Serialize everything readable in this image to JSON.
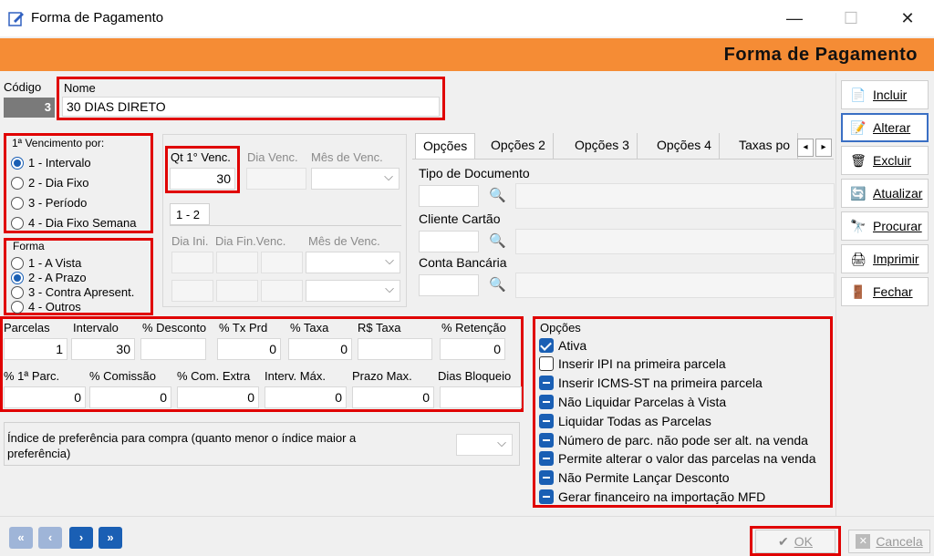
{
  "window": {
    "title": "Forma de Pagamento",
    "minimize_icon": "minimize-icon",
    "maximize_icon": "maximize-icon",
    "close_icon": "close-icon"
  },
  "header": {
    "title": "Forma de Pagamento"
  },
  "codigo": {
    "label": "Código",
    "value": "3"
  },
  "nome": {
    "label": "Nome",
    "value": "30 DIAS DIRETO"
  },
  "vencimento": {
    "label": "1ª Vencimento por:",
    "options": [
      "1 - Intervalo",
      "2 - Dia Fixo",
      "3 - Período",
      "4 - Dia Fixo Semana"
    ],
    "selected": 0
  },
  "forma": {
    "label": "Forma",
    "options": [
      "1 - A Vista",
      "2 - A Prazo",
      "3 - Contra Apresent.",
      "4 - Outros"
    ],
    "selected": 1
  },
  "venc_fields": {
    "qt_label": "Qt 1° Venc.",
    "qt_value": "30",
    "dia_venc_label": "Dia Venc.",
    "mes_venc_label": "Mês de Venc.",
    "period_tab": "1 - 2",
    "dia_ini_label": "Dia Ini.",
    "dia_fin_label": "Dia Fin.Venc.",
    "mes_venc2_label": "Mês de Venc."
  },
  "tabs": [
    "Opções",
    "Opções 2",
    "Opções 3",
    "Opções 4",
    "Taxas po"
  ],
  "tab_fields": {
    "tipo_doc_label": "Tipo de Documento",
    "cliente_cartao_label": "Cliente Cartão",
    "conta_bancaria_label": "Conta Bancária"
  },
  "parcelas_grid": {
    "row1_labels": [
      "Parcelas",
      "Intervalo",
      "% Desconto",
      "% Tx Prd",
      "% Taxa",
      "R$ Taxa",
      "% Retenção"
    ],
    "row1_values": [
      "1",
      "30",
      "",
      "0",
      "0",
      "",
      "0"
    ],
    "row2_labels": [
      "% 1ª Parc.",
      "% Comissão",
      "% Com. Extra",
      "Interv. Máx.",
      "Prazo Max.",
      "Dias Bloqueio"
    ],
    "row2_values": [
      "0",
      "0",
      "0",
      "0",
      "0",
      ""
    ]
  },
  "indice": {
    "label": "Índice de preferência para compra (quanto menor o índice maior a preferência)"
  },
  "opcoes": {
    "label": "Opções",
    "items": [
      {
        "label": "Ativa",
        "state": "checked"
      },
      {
        "label": "Inserir IPI na primeira parcela",
        "state": "unchecked"
      },
      {
        "label": "Inserir ICMS-ST na primeira parcela",
        "state": "indeterminate"
      },
      {
        "label": "Não Liquidar Parcelas à Vista",
        "state": "indeterminate"
      },
      {
        "label": "Liquidar Todas as Parcelas",
        "state": "indeterminate"
      },
      {
        "label": "Número de parc. não pode ser alt. na venda",
        "state": "indeterminate"
      },
      {
        "label": "Permite alterar o valor das parcelas na venda",
        "state": "indeterminate"
      },
      {
        "label": "Não Permite Lançar Desconto",
        "state": "indeterminate"
      },
      {
        "label": "Gerar financeiro na importação MFD",
        "state": "indeterminate"
      }
    ]
  },
  "sidebar": {
    "buttons": [
      {
        "label": "Incluir",
        "icon": "new-document-icon"
      },
      {
        "label": "Alterar",
        "icon": "edit-icon"
      },
      {
        "label": "Excluir",
        "icon": "delete-icon"
      },
      {
        "label": "Atualizar",
        "icon": "refresh-icon"
      },
      {
        "label": "Procurar",
        "icon": "binoculars-icon"
      },
      {
        "label": "Imprimir",
        "icon": "printer-icon"
      },
      {
        "label": "Fechar",
        "icon": "exit-icon"
      }
    ]
  },
  "footer": {
    "ok_label": "OK",
    "cancel_label": "Cancela"
  },
  "colors": {
    "accent_orange": "#f58c35",
    "highlight_red": "#e00000",
    "check_blue": "#1a5fb4"
  }
}
